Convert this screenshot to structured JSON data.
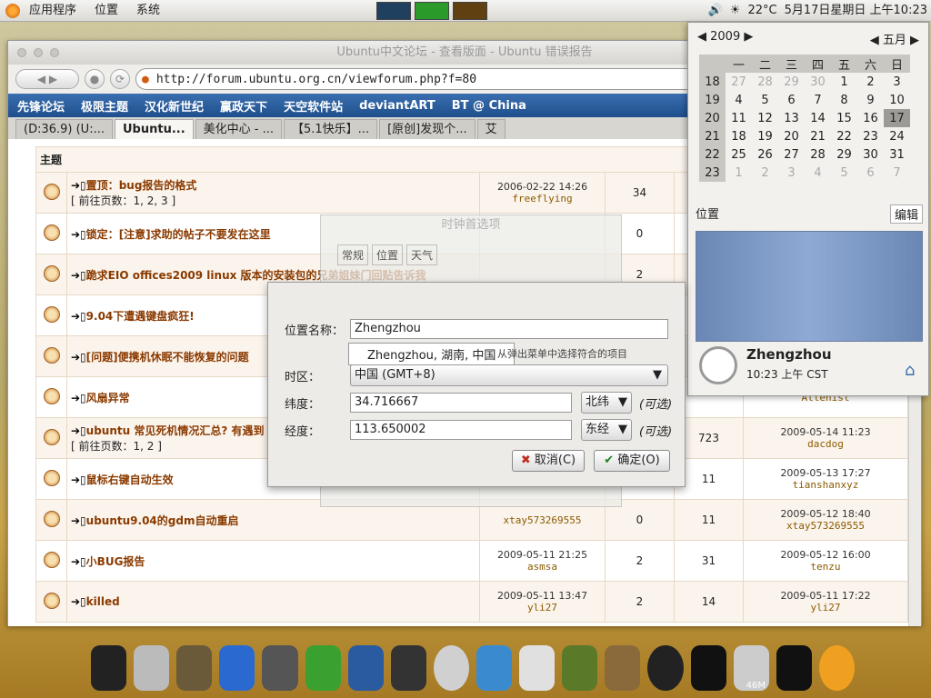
{
  "panel": {
    "menu": [
      "应用程序",
      "位置",
      "系统"
    ],
    "temp": "22°C",
    "datetime": "5月17日星期日 上午10:23"
  },
  "browser": {
    "title": "Ubuntu中文论坛 - 查看版面 - Ubuntu 错误报告",
    "url": "http://forum.ubuntu.org.cn/viewforum.php?f=80",
    "bookmarks": [
      "先锋论坛",
      "极限主题",
      "汉化新世纪",
      "赢政天下",
      "天空软件站",
      "deviantART",
      "BT @ China"
    ],
    "tabs": [
      "(D:36.9) (U:...",
      "Ubuntu...",
      "美化中心 - ...",
      "【5.1快乐】...",
      "[原创]发现个...",
      "艾"
    ],
    "section_header": "主题"
  },
  "topics": [
    {
      "prefix": "置顶：",
      "title": "bug报告的格式",
      "pages": "[ 前往页数：1, 2, 3 ]",
      "date": "2006-02-22 14:26",
      "author": "freeflying",
      "replies": "34",
      "views": "",
      "last": "",
      "lastuser": ""
    },
    {
      "prefix": "锁定：",
      "title": "[注意]求助的帖子不要发在这里",
      "pages": "",
      "date": "",
      "author": "",
      "replies": "0",
      "views": "",
      "last": "",
      "lastuser": ""
    },
    {
      "prefix": "",
      "title": "跪求EIO offices2009 linux 版本的安装包的兄弟姐妹门回贴告诉我",
      "pages": "",
      "date": "",
      "author": "",
      "replies": "2",
      "views": "",
      "last": "",
      "lastuser": ""
    },
    {
      "prefix": "",
      "title": "9.04下遭遇键盘疯狂!",
      "pages": "",
      "date": "",
      "author": "",
      "replies": "",
      "views": "",
      "last": "",
      "lastuser": ""
    },
    {
      "prefix": "",
      "title": "[问题]便携机休眠不能恢复的问题",
      "pages": "",
      "date": "",
      "author": "",
      "replies": "",
      "views": "",
      "last": "",
      "lastuser": ""
    },
    {
      "prefix": "",
      "title": "风扇异常",
      "pages": "",
      "date": "",
      "author": "",
      "replies": "",
      "views": "",
      "last": "",
      "lastuser": "Allenist"
    },
    {
      "prefix": "",
      "title": "ubuntu 常见死机情况汇总? 有遇到",
      "pages": "[ 前往页数：1, 2 ]",
      "date": "",
      "author": "",
      "replies": "",
      "views": "723",
      "last": "2009-05-14 11:23",
      "lastuser": "dacdog"
    },
    {
      "prefix": "",
      "title": "鼠标右键自动生效",
      "pages": "",
      "date": "",
      "author": "",
      "replies": "",
      "views": "11",
      "last": "2009-05-13 17:27",
      "lastuser": "tianshanxyz"
    },
    {
      "prefix": "",
      "title": "ubuntu9.04的gdm自动重启",
      "pages": "",
      "date": "",
      "author": "xtay573269555",
      "replies": "0",
      "views": "11",
      "last": "2009-05-12 18:40",
      "lastuser": "xtay573269555"
    },
    {
      "prefix": "",
      "title": "小BUG报告",
      "pages": "",
      "date": "2009-05-11 21:25",
      "author": "asmsa",
      "replies": "2",
      "views": "31",
      "last": "2009-05-12 16:00",
      "lastuser": "tenzu"
    },
    {
      "prefix": "",
      "title": "killed",
      "pages": "",
      "date": "2009-05-11 13:47",
      "author": "yli27",
      "replies": "2",
      "views": "14",
      "last": "2009-05-11 17:22",
      "lastuser": "yli27"
    }
  ],
  "calendar": {
    "year": "2009",
    "month": "五月",
    "weekdays": [
      "一",
      "二",
      "三",
      "四",
      "五",
      "六",
      "日"
    ],
    "weeks": [
      [
        "18",
        "27",
        "28",
        "29",
        "30",
        "1",
        "2",
        "3"
      ],
      [
        "19",
        "4",
        "5",
        "6",
        "7",
        "8",
        "9",
        "10"
      ],
      [
        "20",
        "11",
        "12",
        "13",
        "14",
        "15",
        "16",
        "17"
      ],
      [
        "21",
        "18",
        "19",
        "20",
        "21",
        "22",
        "23",
        "24"
      ],
      [
        "22",
        "25",
        "26",
        "27",
        "28",
        "29",
        "30",
        "31"
      ],
      [
        "23",
        "1",
        "2",
        "3",
        "4",
        "5",
        "6",
        "7"
      ]
    ],
    "loc_label": "位置",
    "edit_label": "编辑",
    "city": "Zhengzhou",
    "time": "10:23 上午 CST"
  },
  "prefs": {
    "title": "时钟首选项",
    "tabs": [
      "常规",
      "位置",
      "天气"
    ]
  },
  "edit_dialog": {
    "name_label": "位置名称：",
    "name_value": "Zhengzhou",
    "suggestion": "Zhengzhou, 湖南, 中国",
    "hint": "从弹出菜单中选择符合的项目",
    "tz_label": "时区：",
    "tz_value": "中国 (GMT+8)",
    "lat_label": "纬度：",
    "lat_value": "34.716667",
    "lat_dir": "北纬",
    "lon_label": "经度：",
    "lon_value": "113.650002",
    "lon_dir": "东经",
    "optional": "(可选)",
    "cancel": "取消(C)",
    "ok": "确定(O)"
  },
  "dock": {
    "memory": "46M"
  }
}
